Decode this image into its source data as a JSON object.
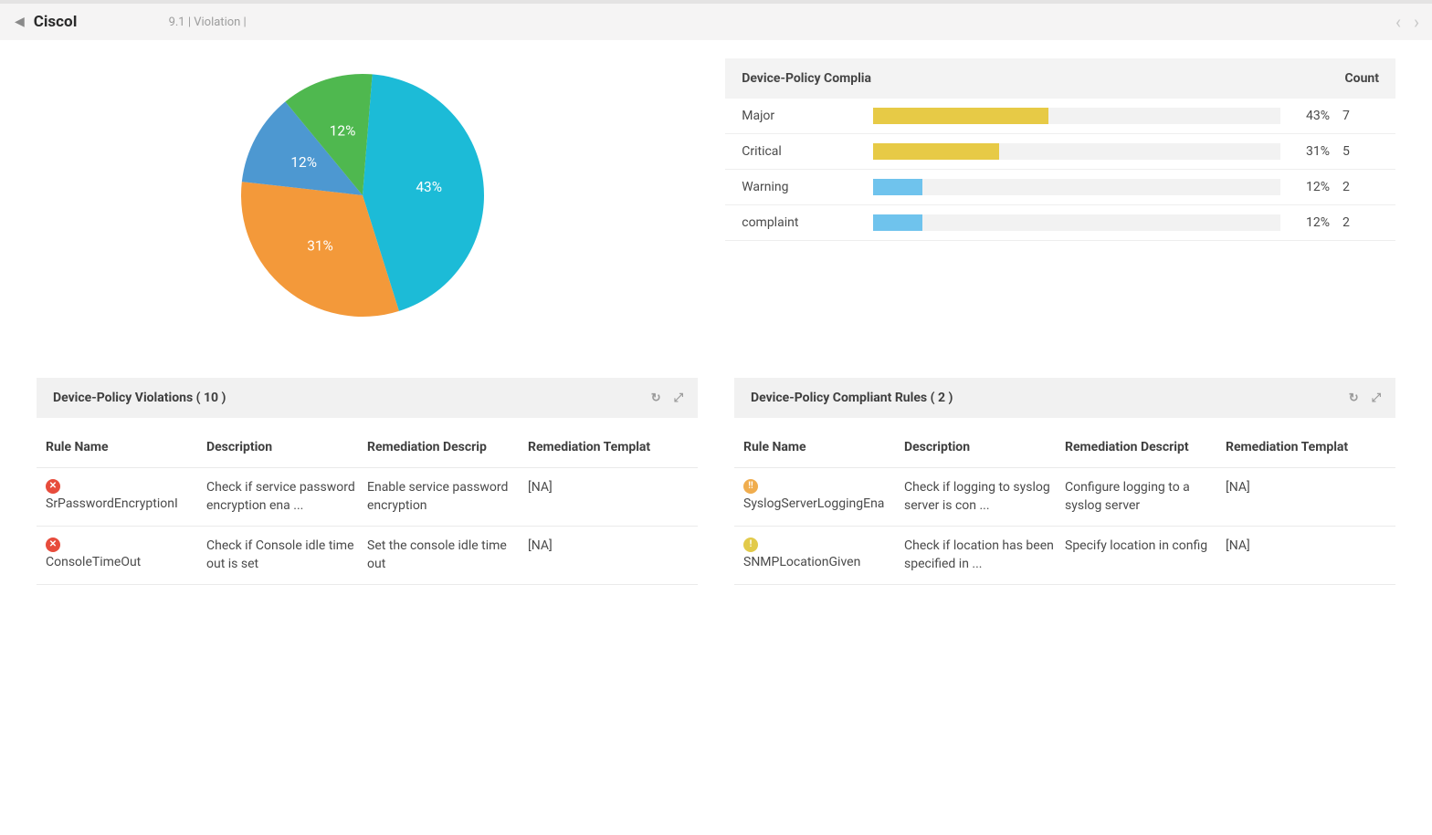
{
  "header": {
    "title": "CiscoI",
    "sub": "9.1 | Violation |"
  },
  "chart_data": {
    "type": "pie",
    "title": "",
    "slices": [
      {
        "label": "Major",
        "value": 43,
        "pct": "43%",
        "color": "#1cbbd7"
      },
      {
        "label": "Critical",
        "value": 31,
        "pct": "31%",
        "color": "#f3993a"
      },
      {
        "label": "Warning",
        "value": 12,
        "pct": "12%",
        "color": "#4d98d1"
      },
      {
        "label": "complaint",
        "value": 12,
        "pct": "12%",
        "color": "#4fb84f"
      }
    ]
  },
  "compliance": {
    "header_left": "Device-Policy Complia",
    "header_right": "Count",
    "rows": [
      {
        "label": "Major",
        "pct": 43,
        "pct_txt": "43%",
        "count": "7",
        "color": "#e7ca46"
      },
      {
        "label": "Critical",
        "pct": 31,
        "pct_txt": "31%",
        "count": "5",
        "color": "#e7ca46"
      },
      {
        "label": "Warning",
        "pct": 12,
        "pct_txt": "12%",
        "count": "2",
        "color": "#6fc3ed"
      },
      {
        "label": "complaint",
        "pct": 12,
        "pct_txt": "12%",
        "count": "2",
        "color": "#6fc3ed"
      }
    ]
  },
  "violations": {
    "title": "Device-Policy Violations ( 10 )",
    "cols": {
      "rule": "Rule Name",
      "desc": "Description",
      "remdesc": "Remediation Descrip",
      "remtmpl": "Remediation Templat"
    },
    "rows": [
      {
        "icon": "critical",
        "icon_glyph": "✕",
        "rule": "SrPasswordEncryptionI",
        "desc": "Check if service password encryption ena ...",
        "remdesc": "Enable service password encryption",
        "remtmpl": "[NA]"
      },
      {
        "icon": "critical",
        "icon_glyph": "✕",
        "rule": "ConsoleTimeOut",
        "desc": "Check if Console idle time out is set",
        "remdesc": "Set the console idle time out",
        "remtmpl": "[NA]"
      }
    ]
  },
  "compliant": {
    "title": "Device-Policy Compliant Rules ( 2 )",
    "cols": {
      "rule": "Rule Name",
      "desc": "Description",
      "remdesc": "Remediation Descript",
      "remtmpl": "Remediation Templat"
    },
    "rows": [
      {
        "icon": "major",
        "icon_glyph": "!!",
        "rule": "SyslogServerLoggingEna",
        "desc": "Check if logging to syslog server is con ...",
        "remdesc": "Configure logging to a syslog server",
        "remtmpl": "[NA]"
      },
      {
        "icon": "warning",
        "icon_glyph": "!",
        "rule": "SNMPLocationGiven",
        "desc": "Check if location has been specified in  ...",
        "remdesc": "Specify location in config",
        "remtmpl": "[NA]"
      }
    ]
  }
}
